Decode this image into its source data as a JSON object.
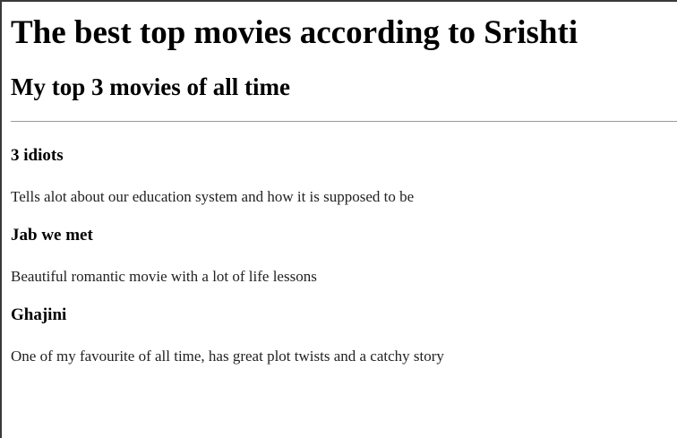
{
  "page": {
    "heading": "The best top movies according to Srishti",
    "subheading": "My top 3 movies of all time"
  },
  "movies": [
    {
      "title": "3 idiots",
      "description": "Tells alot about our education system and how it is supposed to be"
    },
    {
      "title": "Jab we met",
      "description": "Beautiful romantic movie with a lot of life lessons"
    },
    {
      "title": "Ghajini",
      "description": "One of my favourite of all time, has great plot twists and a catchy story"
    }
  ]
}
